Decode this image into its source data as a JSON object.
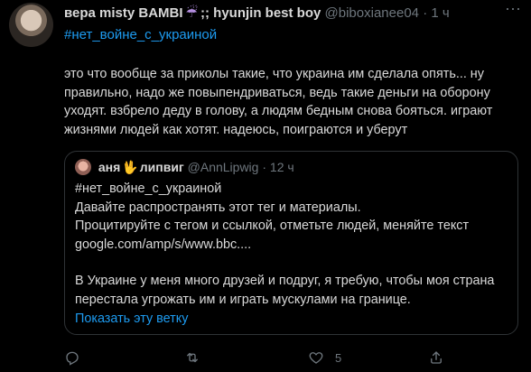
{
  "author": {
    "name": "вера misty BAMBI",
    "badge": "☔",
    "suffix": ";; hyunjin best boy",
    "handle": "@biboxianee04",
    "dot": "·",
    "time": "1 ч"
  },
  "more_icon": "···",
  "hashtag": "#нет_войне_с_украиной",
  "body": "это что вообще за приколы такие, что украина им сделала опять... ну правильно, надо же повыпендриваться, ведь такие деньги на оборону уходят. взбрело деду в голову, а людям бедным снова бояться. играют жизнями людей как хотят. надеюсь, поиграются и уберут",
  "quote": {
    "name": "аня",
    "hand": "🖖",
    "name2": "липвиг",
    "handle": "@AnnLipwig",
    "dot": "·",
    "time": "12 ч",
    "lines": [
      "#нет_войне_с_украиной",
      "Давайте распространять этот тег и материалы.",
      "Процитируйте с тегом и ссылкой, отметьте людей, меняйте текст",
      "google.com/amp/s/www.bbc....",
      "",
      "В Украине у меня много друзей и подруг, я требую, чтобы моя страна перестала угрожать им и играть мускулами на границе."
    ],
    "show_thread": "Показать эту ветку"
  },
  "actions": {
    "reply_count": "",
    "retweet_count": "",
    "like_count": "5",
    "share_count": ""
  }
}
